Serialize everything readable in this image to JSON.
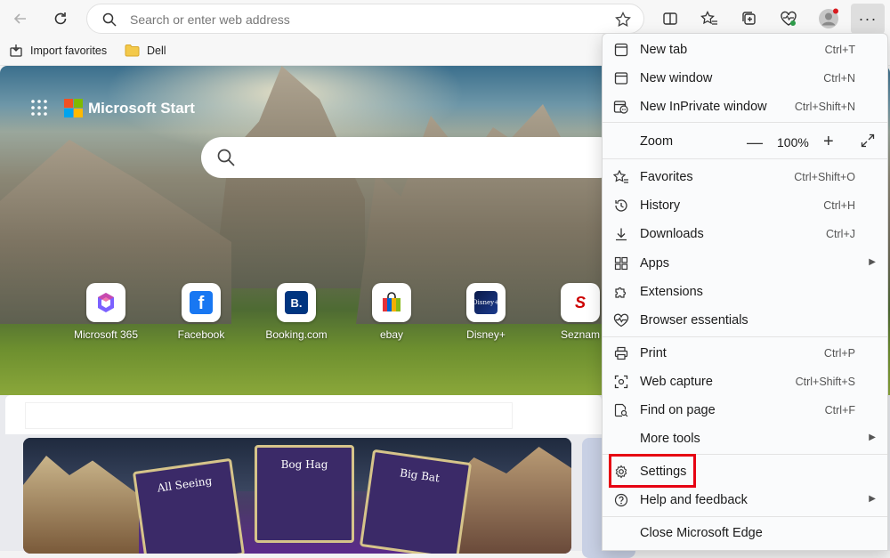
{
  "toolbar": {
    "address_placeholder": "Search or enter web address",
    "more_label": "···"
  },
  "favorites_bar": {
    "items": [
      {
        "label": "Import favorites"
      },
      {
        "label": "Dell"
      }
    ]
  },
  "page": {
    "brand": "Microsoft Start",
    "tiles": [
      {
        "label": "Microsoft 365"
      },
      {
        "label": "Facebook",
        "glyph": "f"
      },
      {
        "label": "Booking.com",
        "glyph": "B."
      },
      {
        "label": "ebay"
      },
      {
        "label": "Disney+"
      },
      {
        "label": "Seznam",
        "glyph": "S"
      }
    ],
    "game_cards": [
      {
        "title": "All Seeing"
      },
      {
        "title": "Bog Hag"
      },
      {
        "title": "Big Bat"
      }
    ]
  },
  "menu": {
    "new_tab": {
      "label": "New tab",
      "shortcut": "Ctrl+T"
    },
    "new_window": {
      "label": "New window",
      "shortcut": "Ctrl+N"
    },
    "new_inprivate": {
      "label": "New InPrivate window",
      "shortcut": "Ctrl+Shift+N"
    },
    "zoom": {
      "label": "Zoom",
      "minus": "—",
      "value": "100%",
      "plus": "+"
    },
    "favorites": {
      "label": "Favorites",
      "shortcut": "Ctrl+Shift+O"
    },
    "history": {
      "label": "History",
      "shortcut": "Ctrl+H"
    },
    "downloads": {
      "label": "Downloads",
      "shortcut": "Ctrl+J"
    },
    "apps": {
      "label": "Apps"
    },
    "extensions": {
      "label": "Extensions"
    },
    "browser_essentials": {
      "label": "Browser essentials"
    },
    "print": {
      "label": "Print",
      "shortcut": "Ctrl+P"
    },
    "web_capture": {
      "label": "Web capture",
      "shortcut": "Ctrl+Shift+S"
    },
    "find_on_page": {
      "label": "Find on page",
      "shortcut": "Ctrl+F"
    },
    "more_tools": {
      "label": "More tools"
    },
    "settings": {
      "label": "Settings"
    },
    "help_feedback": {
      "label": "Help and feedback"
    },
    "close_edge": {
      "label": "Close Microsoft Edge"
    }
  },
  "colors": {
    "highlight": "#e60012",
    "ms_red": "#f25022",
    "ms_green": "#7fba00",
    "ms_blue": "#00a4ef",
    "ms_yellow": "#ffb900"
  }
}
